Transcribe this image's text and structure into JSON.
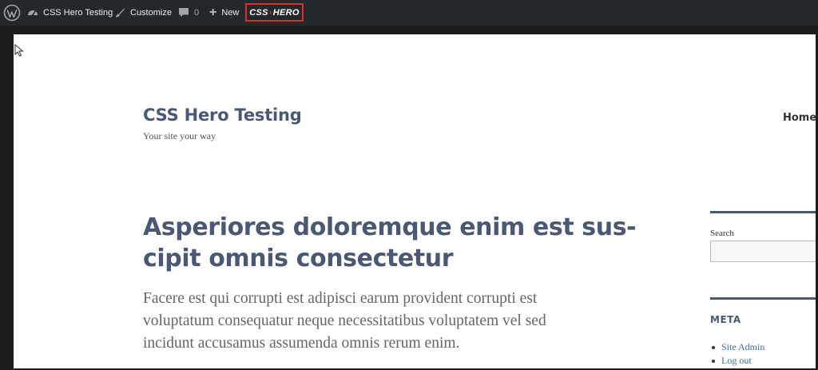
{
  "adminbar": {
    "site_name": "CSS Hero Testing",
    "customize_label": "Customize",
    "comments_count": "0",
    "new_label": "New",
    "csshero_left": "CSS",
    "csshero_right": "HERO"
  },
  "site": {
    "title": "CSS Hero Testing",
    "tagline": "Your site your way"
  },
  "nav": {
    "home_label": "Home"
  },
  "post": {
    "title": "Asperiores doloremque enim est sus-cipit omnis consectetur",
    "title_line1": "Asperiores doloremque enim est sus-",
    "title_line2": "cipit omnis consectetur",
    "excerpt_line1": "Facere est qui corrupti est adipisci earum provident corrupti est",
    "excerpt_line2": "voluptatum consequatur neque necessitatibus voluptatem vel sed",
    "excerpt_line3": "incidunt accusamus assumenda omnis rerum enim."
  },
  "sidebar": {
    "search_label": "Search",
    "search_value": "",
    "meta_title": "META",
    "meta_items": [
      {
        "label": "Site Admin"
      },
      {
        "label": "Log out"
      }
    ]
  },
  "colors": {
    "adminbar_bg": "#23282d",
    "accent": "#4a5876",
    "highlight_border": "#e02b2b",
    "link": "#3a6ea5"
  },
  "icons": [
    "wordpress-icon",
    "dashboard-icon",
    "brush-icon",
    "comment-icon",
    "plus-icon",
    "cursor-icon"
  ]
}
